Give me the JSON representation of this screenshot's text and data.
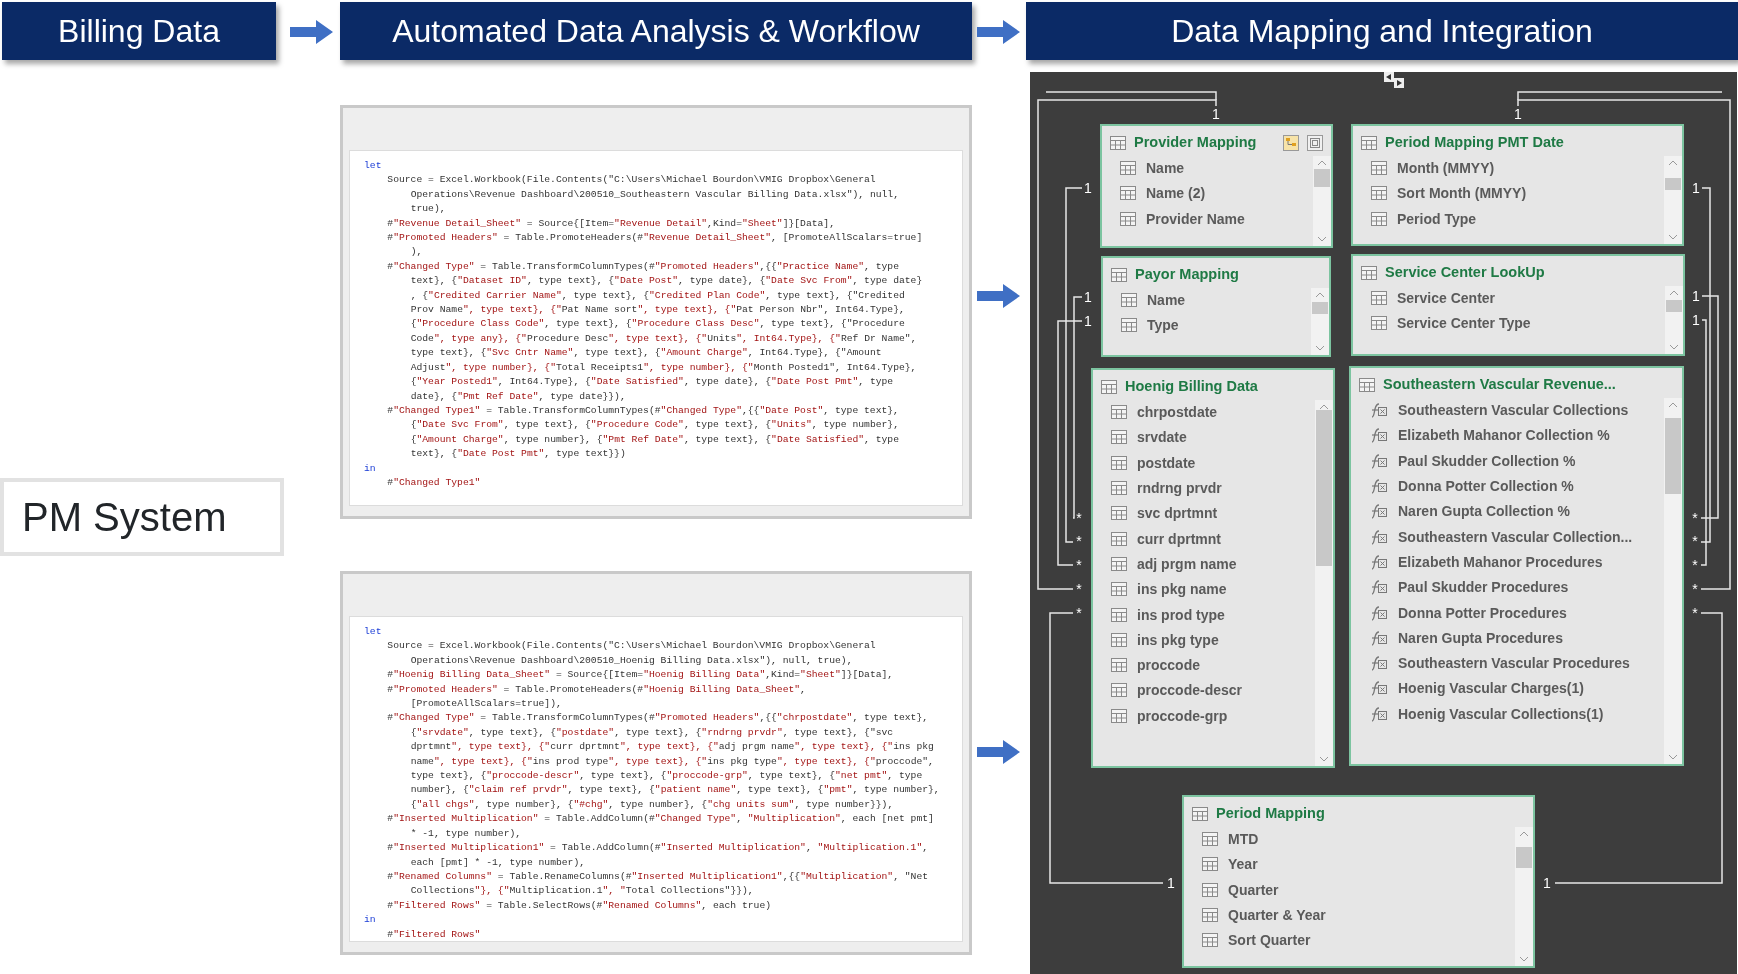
{
  "headers": [
    {
      "title": "Billing Data"
    },
    {
      "title": "Automated Data Analysis & Workflow"
    },
    {
      "title": "Data Mapping and Integration"
    }
  ],
  "source_system": {
    "label": "PM System"
  },
  "query_editors": [
    {
      "lines": [
        {
          "kind": "keyword",
          "text": "let"
        },
        {
          "kind": "step",
          "text": "Source = Excel.Workbook(File.Contents(\"C:\\Users\\Michael Bourdon\\VMIG Dropbox\\General"
        },
        {
          "kind": "cont",
          "text": "Operations\\Revenue Dashboard\\200510_Southeastern Vascular Billing Data.xlsx\"), null,"
        },
        {
          "kind": "cont",
          "text": "true),"
        },
        {
          "kind": "step",
          "text": "#\"Revenue Detail_Sheet\" = Source{[Item=\"Revenue Detail\",Kind=\"Sheet\"]}[Data],"
        },
        {
          "kind": "step",
          "text": "#\"Promoted Headers\" = Table.PromoteHeaders(#\"Revenue Detail_Sheet\", [PromoteAllScalars=true]"
        },
        {
          "kind": "cont",
          "text": "),"
        },
        {
          "kind": "step",
          "text": "#\"Changed Type\" = Table.TransformColumnTypes(#\"Promoted Headers\",{{\"Practice Name\", type"
        },
        {
          "kind": "cont",
          "text": "text}, {\"Dataset ID\", type text}, {\"Date Post\", type date}, {\"Date Svc From\", type date}"
        },
        {
          "kind": "cont",
          "text": ", {\"Credited Carrier Name\", type text}, {\"Credited Plan Code\", type text}, {\"Credited"
        },
        {
          "kind": "cont",
          "text": "Prov Name\", type text}, {\"Pat Name sort\", type text}, {\"Pat Person Nbr\", Int64.Type},"
        },
        {
          "kind": "cont",
          "text": "{\"Procedure Class Code\", type text}, {\"Procedure Class Desc\", type text}, {\"Procedure"
        },
        {
          "kind": "cont",
          "text": "Code\", type any}, {\"Procedure Desc\", type text}, {\"Units\", Int64.Type}, {\"Ref Dr Name\","
        },
        {
          "kind": "cont",
          "text": "type text}, {\"Svc Cntr Name\", type text}, {\"Amount Charge\", Int64.Type}, {\"Amount"
        },
        {
          "kind": "cont",
          "text": "Adjust\", type number}, {\"Total Receipts1\", type number}, {\"Month Posted1\", Int64.Type},"
        },
        {
          "kind": "cont",
          "text": "{\"Year Posted1\", Int64.Type}, {\"Date Satisfied\", type date}, {\"Date Post Pmt\", type"
        },
        {
          "kind": "cont",
          "text": "date}, {\"Pmt Ref Date\", type date}}),"
        },
        {
          "kind": "step",
          "text": "#\"Changed Type1\" = Table.TransformColumnTypes(#\"Changed Type\",{{\"Date Post\", type text},"
        },
        {
          "kind": "cont",
          "text": "{\"Date Svc From\", type text}, {\"Procedure Code\", type text}, {\"Units\", type number},"
        },
        {
          "kind": "cont",
          "text": "{\"Amount Charge\", type number}, {\"Pmt Ref Date\", type text}, {\"Date Satisfied\", type"
        },
        {
          "kind": "cont",
          "text": "text}, {\"Date Post Pmt\", type text}})"
        },
        {
          "kind": "keyword",
          "text": "in"
        },
        {
          "kind": "step",
          "text": "#\"Changed Type1\""
        }
      ]
    },
    {
      "lines": [
        {
          "kind": "keyword",
          "text": "let"
        },
        {
          "kind": "step",
          "text": "Source = Excel.Workbook(File.Contents(\"C:\\Users\\Michael Bourdon\\VMIG Dropbox\\General"
        },
        {
          "kind": "cont",
          "text": "Operations\\Revenue Dashboard\\200510_Hoenig Billing Data.xlsx\"), null, true),"
        },
        {
          "kind": "step",
          "text": "#\"Hoenig Billing Data_Sheet\" = Source{[Item=\"Hoenig Billing Data\",Kind=\"Sheet\"]}[Data],"
        },
        {
          "kind": "step",
          "text": "#\"Promoted Headers\" = Table.PromoteHeaders(#\"Hoenig Billing Data_Sheet\","
        },
        {
          "kind": "cont",
          "text": "[PromoteAllScalars=true]),"
        },
        {
          "kind": "step",
          "text": "#\"Changed Type\" = Table.TransformColumnTypes(#\"Promoted Headers\",{{\"chrpostdate\", type text},"
        },
        {
          "kind": "cont",
          "text": "{\"srvdate\", type text}, {\"postdate\", type text}, {\"rndrng prvdr\", type text}, {\"svc"
        },
        {
          "kind": "cont",
          "text": "dprtmnt\", type text}, {\"curr dprtmnt\", type text}, {\"adj prgm name\", type text}, {\"ins pkg"
        },
        {
          "kind": "cont",
          "text": "name\", type text}, {\"ins prod type\", type text}, {\"ins pkg type\", type text}, {\"proccode\","
        },
        {
          "kind": "cont",
          "text": "type text}, {\"proccode-descr\", type text}, {\"proccode-grp\", type text}, {\"net pmt\", type"
        },
        {
          "kind": "cont",
          "text": "number}, {\"claim ref prvdr\", type text}, {\"patient name\", type text}, {\"pmt\", type number},"
        },
        {
          "kind": "cont",
          "text": "{\"all chgs\", type number}, {\"#chg\", type number}, {\"chg units sum\", type number}}),"
        },
        {
          "kind": "step",
          "text": "#\"Inserted Multiplication\" = Table.AddColumn(#\"Changed Type\", \"Multiplication\", each [net pmt]"
        },
        {
          "kind": "cont",
          "text": "* -1, type number),"
        },
        {
          "kind": "step",
          "text": "#\"Inserted Multiplication1\" = Table.AddColumn(#\"Inserted Multiplication\", \"Multiplication.1\","
        },
        {
          "kind": "cont",
          "text": "each [pmt] * -1, type number),"
        },
        {
          "kind": "step",
          "text": "#\"Renamed Columns\" = Table.RenameColumns(#\"Inserted Multiplication1\",{{\"Multiplication\", \"Net"
        },
        {
          "kind": "cont",
          "text": "Collections\"}, {\"Multiplication.1\", \"Total Collections\"}}),"
        },
        {
          "kind": "step",
          "text": "#\"Filtered Rows\" = Table.SelectRows(#\"Renamed Columns\", each true)"
        },
        {
          "kind": "keyword",
          "text": "in"
        },
        {
          "kind": "step",
          "text": "#\"Filtered Rows\""
        }
      ]
    }
  ],
  "model": {
    "tables": [
      {
        "title": "Provider Mapping",
        "fields": [
          {
            "name": "Name",
            "kind": "column"
          },
          {
            "name": "Name (2)",
            "kind": "column"
          },
          {
            "name": "Provider Name",
            "kind": "column"
          }
        ]
      },
      {
        "title": "Period Mapping PMT Date",
        "fields": [
          {
            "name": "Month (MMYY)",
            "kind": "column"
          },
          {
            "name": "Sort Month (MMYY)",
            "kind": "column"
          },
          {
            "name": "Period Type",
            "kind": "column"
          }
        ]
      },
      {
        "title": "Payor Mapping",
        "fields": [
          {
            "name": "Name",
            "kind": "column"
          },
          {
            "name": "Type",
            "kind": "column"
          }
        ]
      },
      {
        "title": "Service Center LookUp",
        "fields": [
          {
            "name": "Service Center",
            "kind": "column"
          },
          {
            "name": "Service Center Type",
            "kind": "column"
          }
        ]
      },
      {
        "title": "Hoenig Billing Data",
        "fields": [
          {
            "name": "chrpostdate",
            "kind": "column"
          },
          {
            "name": "srvdate",
            "kind": "column"
          },
          {
            "name": "postdate",
            "kind": "column"
          },
          {
            "name": "rndrng prvdr",
            "kind": "column"
          },
          {
            "name": "svc dprtmnt",
            "kind": "column"
          },
          {
            "name": "curr dprtmnt",
            "kind": "column"
          },
          {
            "name": "adj prgm name",
            "kind": "column"
          },
          {
            "name": "ins pkg name",
            "kind": "column"
          },
          {
            "name": "ins prod type",
            "kind": "column"
          },
          {
            "name": "ins pkg type",
            "kind": "column"
          },
          {
            "name": "proccode",
            "kind": "column"
          },
          {
            "name": "proccode-descr",
            "kind": "column"
          },
          {
            "name": "proccode-grp",
            "kind": "column"
          }
        ]
      },
      {
        "title": "Southeastern Vascular Revenue...",
        "fields": [
          {
            "name": "Southeastern Vascular Collections",
            "kind": "measure"
          },
          {
            "name": "Elizabeth Mahanor Collection %",
            "kind": "measure"
          },
          {
            "name": "Paul Skudder Collection %",
            "kind": "measure"
          },
          {
            "name": "Donna Potter Collection %",
            "kind": "measure"
          },
          {
            "name": "Naren Gupta Collection %",
            "kind": "measure"
          },
          {
            "name": "Southeastern Vascular Collection...",
            "kind": "measure"
          },
          {
            "name": "Elizabeth Mahanor Procedures",
            "kind": "measure"
          },
          {
            "name": "Paul Skudder Procedures",
            "kind": "measure"
          },
          {
            "name": "Donna Potter Procedures",
            "kind": "measure"
          },
          {
            "name": "Naren Gupta Procedures",
            "kind": "measure"
          },
          {
            "name": "Southeastern Vascular Procedures",
            "kind": "measure"
          },
          {
            "name": "Hoenig Vascular Charges(1)",
            "kind": "measure"
          },
          {
            "name": "Hoenig Vascular Collections(1)",
            "kind": "measure"
          }
        ]
      },
      {
        "title": "Period Mapping",
        "fields": [
          {
            "name": "MTD",
            "kind": "column"
          },
          {
            "name": "Year",
            "kind": "column"
          },
          {
            "name": "Quarter",
            "kind": "column"
          },
          {
            "name": "Quarter & Year",
            "kind": "column"
          },
          {
            "name": "Sort Quarter",
            "kind": "column"
          }
        ]
      }
    ],
    "cardinality_labels": [
      "1",
      "1",
      "1",
      "1",
      "1",
      "1",
      "1",
      "1",
      "*",
      "*",
      "*",
      "*",
      "*",
      "*",
      "*",
      "*",
      "*",
      "*",
      "1",
      "1"
    ]
  }
}
